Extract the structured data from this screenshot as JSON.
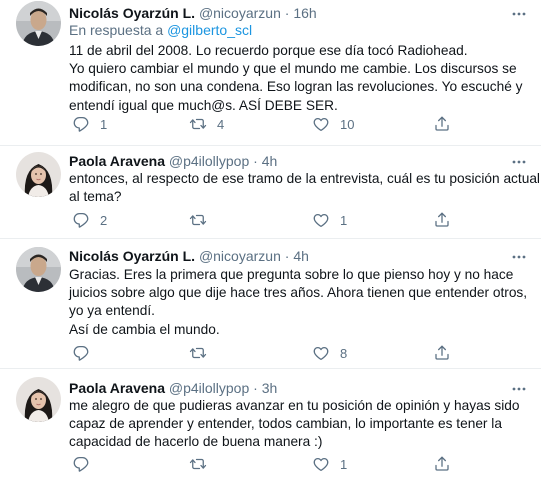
{
  "tweets": [
    {
      "name": "Nicolás Oyarzún L.",
      "handle": "@nicoyarzun",
      "dot": "·",
      "time": "16h",
      "reply_prefix": "En respuesta a",
      "reply_to": "@gilberto_scl",
      "lines": [
        "11 de abril del 2008. Lo recuerdo porque ese día tocó Radiohead.",
        "Yo quiero cambiar el mundo y que el mundo me cambie. Los discursos se",
        "modifican, no son una condena. Eso logran las revoluciones. Yo escuché y",
        "entendí igual que much@s. ASÍ DEBE SER."
      ],
      "counts": {
        "reply": "1",
        "retweet": "4",
        "like": "10"
      }
    },
    {
      "name": "Paola Aravena",
      "handle": "@p4ilollypop",
      "dot": "·",
      "time": "4h",
      "lines": [
        "entonces, al respecto de ese tramo de la entrevista, cuál es tu posición actual",
        "al tema?"
      ],
      "counts": {
        "reply": "2",
        "retweet": "",
        "like": "1"
      }
    },
    {
      "name": "Nicolás Oyarzún L.",
      "handle": "@nicoyarzun",
      "dot": "·",
      "time": "4h",
      "lines": [
        "Gracias. Eres la primera que pregunta sobre lo que pienso hoy y no hace",
        "juicios sobre algo que dije hace tres años. Ahora tienen que entender otros,",
        "yo ya entendí.",
        "Así de cambia el mundo."
      ],
      "counts": {
        "reply": "",
        "retweet": "",
        "like": "8"
      }
    },
    {
      "name": "Paola Aravena",
      "handle": "@p4ilollypop",
      "dot": "·",
      "time": "3h",
      "lines": [
        "me alegro de que pudieras avanzar en tu posición de opinión y hayas sido",
        "capaz de aprender y entender, todos cambian, lo importante es tener la",
        "capacidad de hacerlo de buena manera :)"
      ],
      "counts": {
        "reply": "",
        "retweet": "",
        "like": "1"
      }
    }
  ],
  "icons": {
    "more": "more-horizontal-icon",
    "reply": "reply-bubble-icon",
    "retweet": "retweet-icon",
    "like": "heart-outline-icon",
    "share": "share-upload-icon"
  },
  "colors": {
    "text": "#0f1419",
    "muted": "#5b7083",
    "link": "#1b95e0",
    "divider": "#ebeef0"
  }
}
